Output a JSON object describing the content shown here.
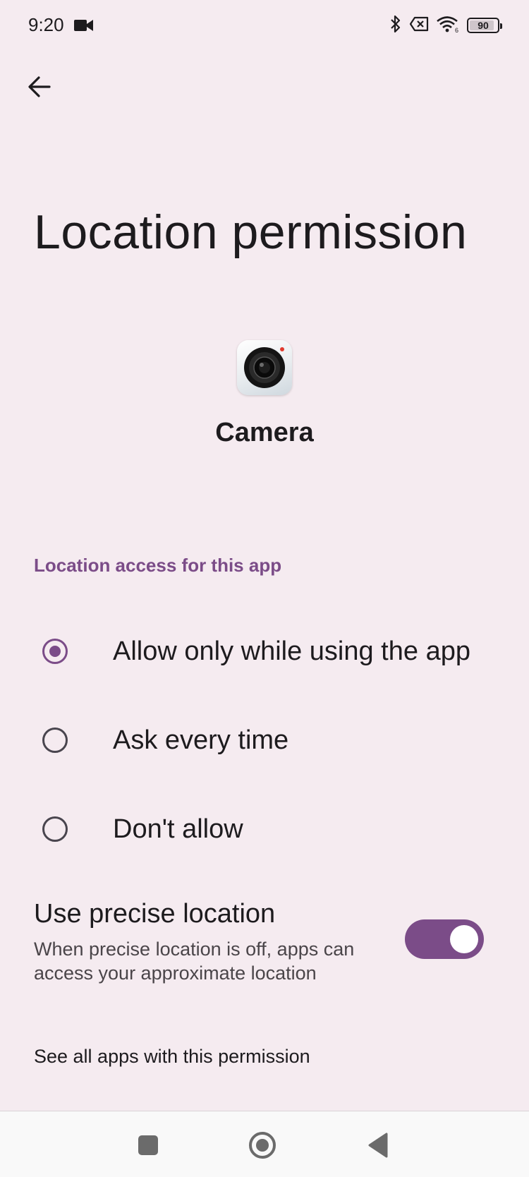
{
  "status_bar": {
    "time": "9:20",
    "battery_level": "90",
    "icons": [
      "video-recording-icon",
      "bluetooth-icon",
      "no-sim-icon",
      "wifi-6-icon",
      "battery-icon"
    ]
  },
  "header": {
    "back_icon": "arrow-back-icon",
    "title": "Location permission"
  },
  "app": {
    "name": "Camera",
    "icon": "camera-app-icon"
  },
  "section": {
    "header": "Location access for this app"
  },
  "options": [
    {
      "label": "Allow only while using the app",
      "selected": true
    },
    {
      "label": "Ask every time",
      "selected": false
    },
    {
      "label": "Don't allow",
      "selected": false
    }
  ],
  "precise_location": {
    "title": "Use precise location",
    "summary": "When precise location is off, apps can access your approximate location",
    "enabled": true
  },
  "see_all_link": "See all apps with this permission",
  "nav_bar": {
    "icons": [
      "recents-square-icon",
      "home-circle-icon",
      "back-triangle-icon"
    ]
  },
  "colors": {
    "background": "#f5ebf0",
    "accent": "#7b4c88",
    "text": "#1d1b1e",
    "secondary_text": "#4a4549"
  }
}
